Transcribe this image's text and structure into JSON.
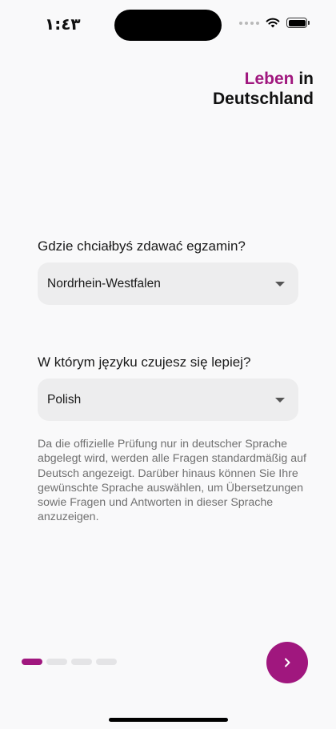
{
  "status_bar": {
    "time": "١:٤٣"
  },
  "logo": {
    "accent_word": "Leben",
    "word_in": "in",
    "word_country": "Deutschland",
    "accent_color": "#a0177e"
  },
  "exam_location": {
    "label": "Gdzie chciałbyś zdawać egzamin?",
    "selected": "Nordrhein-Westfalen"
  },
  "language": {
    "label": "W którym języku czujesz się lepiej?",
    "selected": "Polish"
  },
  "info_text": "Da die offizielle Prüfung nur in deutscher Sprache abgelegt wird, werden alle Fragen standardmäßig auf Deutsch angezeigt. Darüber hinaus können Sie Ihre gewünschte Sprache auswählen, um Übersetzungen sowie Fragen und Antworten in dieser Sprache anzuzeigen.",
  "pager": {
    "total_pages": 4,
    "current_page": 1
  },
  "icons": {
    "next": "chevron-right-icon",
    "dropdown": "caret-down-icon",
    "wifi": "wifi-icon",
    "battery": "battery-icon"
  }
}
